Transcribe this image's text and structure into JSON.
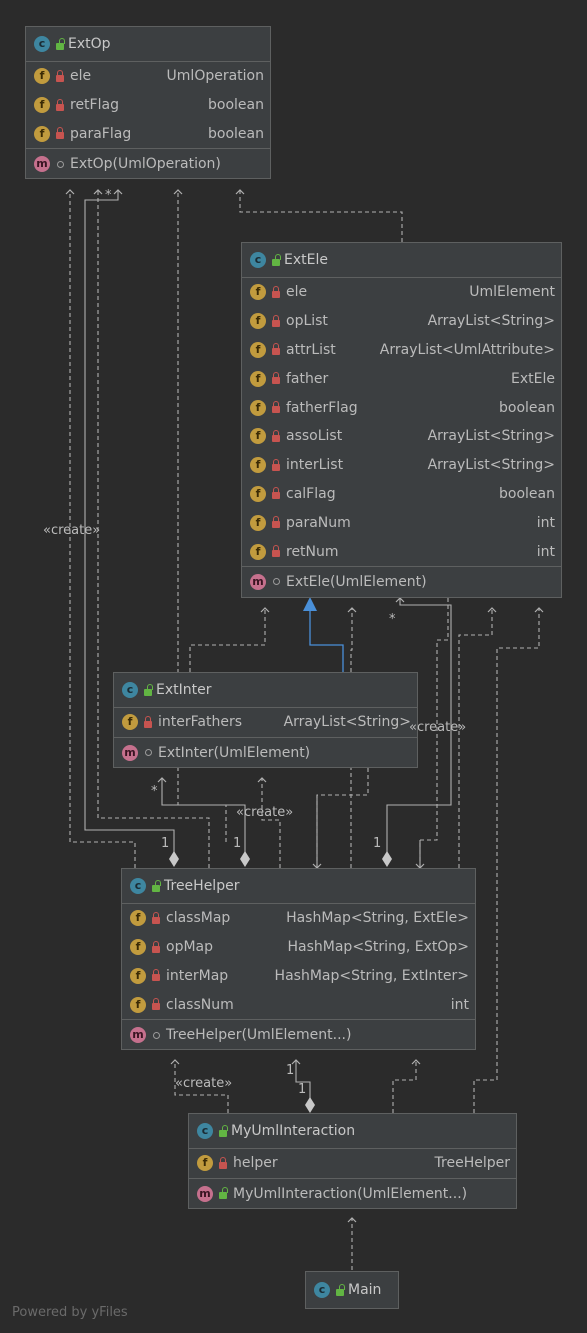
{
  "classes": {
    "extop": {
      "name": "ExtOp",
      "fields": [
        {
          "name": "ele",
          "type": "UmlOperation"
        },
        {
          "name": "retFlag",
          "type": "boolean"
        },
        {
          "name": "paraFlag",
          "type": "boolean"
        }
      ],
      "methods": [
        {
          "name": "ExtOp(UmlOperation)"
        }
      ]
    },
    "extele": {
      "name": "ExtEle",
      "fields": [
        {
          "name": "ele",
          "type": "UmlElement"
        },
        {
          "name": "opList",
          "type": "ArrayList<String>"
        },
        {
          "name": "attrList",
          "type": "ArrayList<UmlAttribute>"
        },
        {
          "name": "father",
          "type": "ExtEle"
        },
        {
          "name": "fatherFlag",
          "type": "boolean"
        },
        {
          "name": "assoList",
          "type": "ArrayList<String>"
        },
        {
          "name": "interList",
          "type": "ArrayList<String>"
        },
        {
          "name": "calFlag",
          "type": "boolean"
        },
        {
          "name": "paraNum",
          "type": "int"
        },
        {
          "name": "retNum",
          "type": "int"
        }
      ],
      "methods": [
        {
          "name": "ExtEle(UmlElement)"
        }
      ]
    },
    "extinter": {
      "name": "ExtInter",
      "fields": [
        {
          "name": "interFathers",
          "type": "ArrayList<String>"
        }
      ],
      "methods": [
        {
          "name": "ExtInter(UmlElement)"
        }
      ]
    },
    "treehelper": {
      "name": "TreeHelper",
      "fields": [
        {
          "name": "classMap",
          "type": "HashMap<String, ExtEle>"
        },
        {
          "name": "opMap",
          "type": "HashMap<String, ExtOp>"
        },
        {
          "name": "interMap",
          "type": "HashMap<String, ExtInter>"
        },
        {
          "name": "classNum",
          "type": "int"
        }
      ],
      "methods": [
        {
          "name": "TreeHelper(UmlElement...)"
        }
      ]
    },
    "myuml": {
      "name": "MyUmlInteraction",
      "fields": [
        {
          "name": "helper",
          "type": "TreeHelper"
        }
      ],
      "methods": [
        {
          "name": "MyUmlInteraction(UmlElement...)"
        }
      ]
    },
    "main": {
      "name": "Main"
    }
  },
  "labels": {
    "create": "«create»",
    "many": "*",
    "one": "1"
  },
  "icons": {
    "class": "class-icon",
    "field": "field-icon",
    "method": "method-icon",
    "lock": "lock-icon"
  },
  "colors": {
    "background": "#2b2b2b",
    "box": "#3c3f41",
    "edge": "#b0b0b0",
    "inheritance": "#4a90d9"
  },
  "watermark": "Powered by yFiles"
}
